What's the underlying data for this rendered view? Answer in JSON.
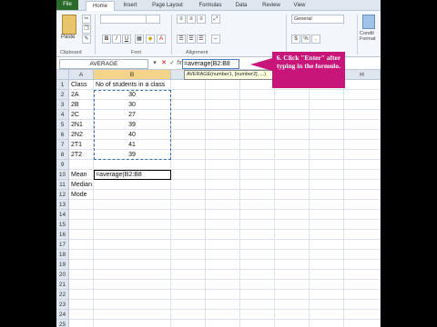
{
  "ribbon": {
    "tabs": [
      "File",
      "Home",
      "Insert",
      "Page Layout",
      "Formulas",
      "Data",
      "Review",
      "View"
    ],
    "paste_label": "Paste",
    "clipboard_label": "Clipboard",
    "font_label": "Font",
    "alignment_label": "Alignment",
    "number_format": "General",
    "condition_label": "Condit Format"
  },
  "formula_bar": {
    "name_box": "AVERAGE",
    "formula": "=average(B2:B8",
    "tooltip": "AVERAGE(number1, [number2], ...)"
  },
  "callout": {
    "text": "6. Click \"Enter\" after typing in the formulo."
  },
  "sheet": {
    "columns": [
      "A",
      "B",
      "C",
      "D",
      "E",
      "F",
      "G",
      "H"
    ],
    "rows": [
      {
        "num": "1",
        "a": "Class",
        "b": "No of students in a class"
      },
      {
        "num": "2",
        "a": "2A",
        "b": "30"
      },
      {
        "num": "3",
        "a": "2B",
        "b": "30"
      },
      {
        "num": "4",
        "a": "2C",
        "b": "27"
      },
      {
        "num": "5",
        "a": "2N1",
        "b": "39"
      },
      {
        "num": "6",
        "a": "2N2",
        "b": "40"
      },
      {
        "num": "7",
        "a": "2T1",
        "b": "41"
      },
      {
        "num": "8",
        "a": "2T2",
        "b": "39"
      },
      {
        "num": "9",
        "a": "",
        "b": ""
      },
      {
        "num": "10",
        "a": "Mean",
        "b": "=average(B2:B8"
      },
      {
        "num": "11",
        "a": "Median",
        "b": ""
      },
      {
        "num": "12",
        "a": "Mode",
        "b": ""
      },
      {
        "num": "13",
        "a": "",
        "b": ""
      },
      {
        "num": "14",
        "a": "",
        "b": ""
      },
      {
        "num": "15",
        "a": "",
        "b": ""
      },
      {
        "num": "16",
        "a": "",
        "b": ""
      },
      {
        "num": "17",
        "a": "",
        "b": ""
      },
      {
        "num": "18",
        "a": "",
        "b": ""
      },
      {
        "num": "19",
        "a": "",
        "b": ""
      },
      {
        "num": "20",
        "a": "",
        "b": ""
      },
      {
        "num": "21",
        "a": "",
        "b": ""
      },
      {
        "num": "22",
        "a": "",
        "b": ""
      },
      {
        "num": "23",
        "a": "",
        "b": ""
      },
      {
        "num": "24",
        "a": "",
        "b": ""
      },
      {
        "num": "25",
        "a": "",
        "b": ""
      }
    ]
  }
}
